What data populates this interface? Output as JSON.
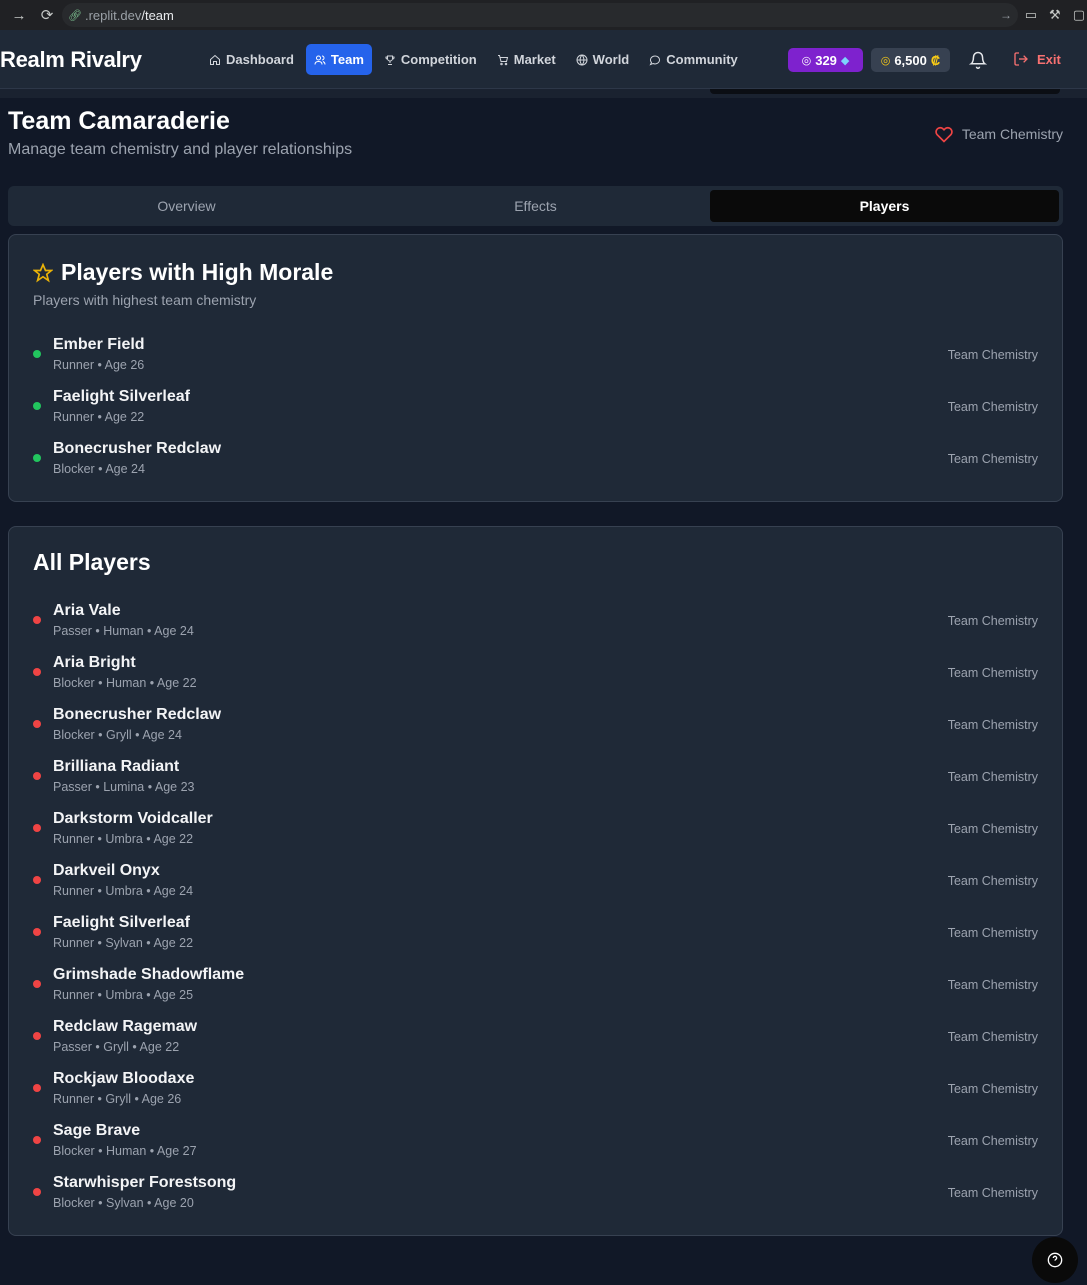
{
  "browser": {
    "url_host": ".replit.dev",
    "url_path": "/team"
  },
  "header": {
    "brand": "Realm Rivalry",
    "nav": [
      {
        "label": "Dashboard",
        "icon": "home-icon"
      },
      {
        "label": "Team",
        "icon": "users-icon"
      },
      {
        "label": "Competition",
        "icon": "trophy-icon"
      },
      {
        "label": "Market",
        "icon": "cart-icon"
      },
      {
        "label": "World",
        "icon": "globe-icon"
      },
      {
        "label": "Community",
        "icon": "chat-icon"
      }
    ],
    "gems": "329",
    "coins": "6,500",
    "coin_symbol": "₡",
    "exit_label": "Exit"
  },
  "page": {
    "title": "Team Camaraderie",
    "subtitle": "Manage team chemistry and player relationships",
    "chemistry_link": "Team Chemistry"
  },
  "tabs": [
    {
      "label": "Overview",
      "active": false
    },
    {
      "label": "Effects",
      "active": false
    },
    {
      "label": "Players",
      "active": true
    }
  ],
  "high_morale": {
    "title": "Players with High Morale",
    "subtitle": "Players with highest team chemistry",
    "players": [
      {
        "name": "Ember Field",
        "meta": "Runner • Age 26",
        "tag": "Team Chemistry"
      },
      {
        "name": "Faelight Silverleaf",
        "meta": "Runner • Age 22",
        "tag": "Team Chemistry"
      },
      {
        "name": "Bonecrusher Redclaw",
        "meta": "Blocker • Age 24",
        "tag": "Team Chemistry"
      }
    ]
  },
  "all_players": {
    "title": "All Players",
    "players": [
      {
        "name": "Aria Vale",
        "meta": "Passer • Human • Age 24",
        "tag": "Team Chemistry"
      },
      {
        "name": "Aria Bright",
        "meta": "Blocker • Human • Age 22",
        "tag": "Team Chemistry"
      },
      {
        "name": "Bonecrusher Redclaw",
        "meta": "Blocker • Gryll • Age 24",
        "tag": "Team Chemistry"
      },
      {
        "name": "Brilliana Radiant",
        "meta": "Passer • Lumina • Age 23",
        "tag": "Team Chemistry"
      },
      {
        "name": "Darkstorm Voidcaller",
        "meta": "Runner • Umbra • Age 22",
        "tag": "Team Chemistry"
      },
      {
        "name": "Darkveil Onyx",
        "meta": "Runner • Umbra • Age 24",
        "tag": "Team Chemistry"
      },
      {
        "name": "Faelight Silverleaf",
        "meta": "Runner • Sylvan • Age 22",
        "tag": "Team Chemistry"
      },
      {
        "name": "Grimshade Shadowflame",
        "meta": "Runner • Umbra • Age 25",
        "tag": "Team Chemistry"
      },
      {
        "name": "Redclaw Ragemaw",
        "meta": "Passer • Gryll • Age 22",
        "tag": "Team Chemistry"
      },
      {
        "name": "Rockjaw Bloodaxe",
        "meta": "Runner • Gryll • Age 26",
        "tag": "Team Chemistry"
      },
      {
        "name": "Sage Brave",
        "meta": "Blocker • Human • Age 27",
        "tag": "Team Chemistry"
      },
      {
        "name": "Starwhisper Forestsong",
        "meta": "Blocker • Sylvan • Age 20",
        "tag": "Team Chemistry"
      }
    ]
  },
  "colors": {
    "accent": "#2563eb",
    "gems_bg": "#7e22ce",
    "high_morale_dot": "#22c55e",
    "low_morale_dot": "#ef4444"
  }
}
